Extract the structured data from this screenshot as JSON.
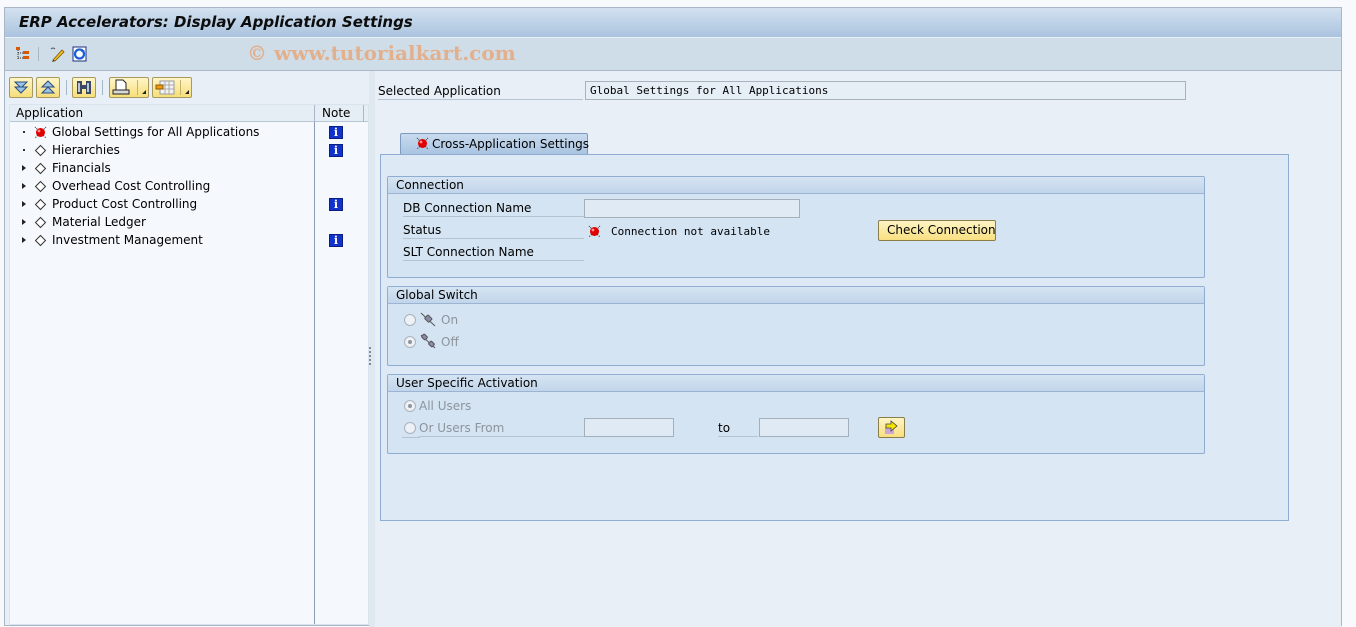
{
  "window": {
    "title": "ERP Accelerators: Display Application Settings",
    "watermark": "© www.tutorialkart.com"
  },
  "app_toolbar": {
    "icons": [
      "hierarchy-icon",
      "edit-pencil-icon",
      "refresh-icon"
    ]
  },
  "alv_toolbar": {
    "buttons": [
      "expand-all-icon",
      "collapse-all-icon",
      "find-icon",
      "print-icon",
      "layout-icon"
    ]
  },
  "tree": {
    "columns": {
      "application": "Application",
      "note": "Note"
    },
    "rows": [
      {
        "label": "Global Settings for All Applications",
        "expander": "leaf",
        "icon": "red-light-icon",
        "note": true
      },
      {
        "label": "Hierarchies",
        "expander": "leaf",
        "icon": "diamond-icon",
        "note": true
      },
      {
        "label": "Financials",
        "expander": "collapsed",
        "icon": "diamond-icon",
        "note": false
      },
      {
        "label": "Overhead Cost Controlling",
        "expander": "collapsed",
        "icon": "diamond-icon",
        "note": false
      },
      {
        "label": "Product Cost Controlling",
        "expander": "collapsed",
        "icon": "diamond-icon",
        "note": true
      },
      {
        "label": "Material Ledger",
        "expander": "collapsed",
        "icon": "diamond-icon",
        "note": false
      },
      {
        "label": "Investment Management",
        "expander": "collapsed",
        "icon": "diamond-icon",
        "note": true
      }
    ],
    "note_glyph": "i"
  },
  "detail": {
    "selected_application_label": "Selected Application",
    "selected_application_value": "Global Settings for All Applications",
    "tab_label": "Cross-Application Settings",
    "connection": {
      "title": "Connection",
      "db_connection_label": "DB Connection Name",
      "db_connection_value": "",
      "status_label": "Status",
      "status_value": "Connection not available",
      "slt_connection_label": "SLT Connection Name",
      "check_button": "Check Connection"
    },
    "global_switch": {
      "title": "Global Switch",
      "options": [
        {
          "label": "On",
          "checked": false
        },
        {
          "label": "Off",
          "checked": true
        }
      ]
    },
    "user_activation": {
      "title": "User Specific Activation",
      "all_users": "All Users",
      "or_users_from": "Or Users From",
      "to_label": "to",
      "from_value": "",
      "to_value": ""
    }
  },
  "colors": {
    "button_yellow": "#f8df80",
    "status_red": "#e00000",
    "info_blue": "#1133cc"
  }
}
